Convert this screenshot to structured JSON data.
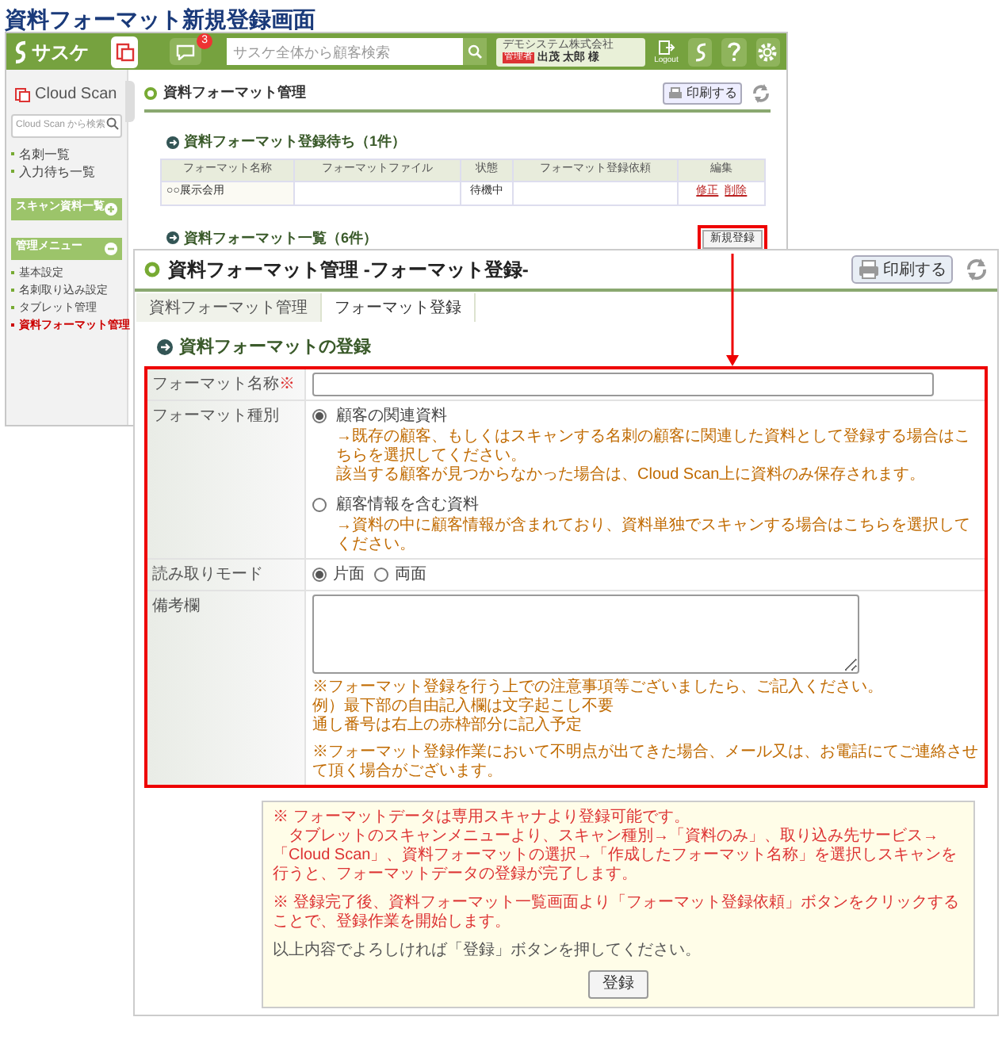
{
  "page_title": "資料フォーマット新規登録画面",
  "back_window": {
    "header": {
      "logo": "サスケ",
      "message_count": "3",
      "search_placeholder": "サスケ全体から顧客検索",
      "company": "デモシステム株式会社",
      "role_badge": "管理者",
      "user_name": "出茂 太郎 様",
      "logout_label": "Logout"
    },
    "sidebar": {
      "title": "Cloud Scan",
      "search_placeholder": "Cloud Scan から検索",
      "links": [
        "名刺一覧",
        "入力待ち一覧"
      ],
      "sections": [
        {
          "label": "スキャン資料一覧",
          "expanded": false
        },
        {
          "label": "管理メニュー",
          "expanded": true,
          "items": [
            {
              "label": "基本設定",
              "selected": false
            },
            {
              "label": "名刺取り込み設定",
              "selected": false
            },
            {
              "label": "タブレット管理",
              "selected": false
            },
            {
              "label": "資料フォーマット管理",
              "selected": true
            }
          ]
        }
      ]
    },
    "main": {
      "title": "資料フォーマット管理",
      "print_label": "印刷する",
      "pending": {
        "heading": "資料フォーマット登録待ち（1件）",
        "columns": [
          "フォーマット名称",
          "フォーマットファイル",
          "状態",
          "フォーマット登録依頼",
          "編集"
        ],
        "rows": [
          {
            "name": "○○展示会用",
            "status": "待機中",
            "actions": [
              "修正",
              "削除"
            ]
          }
        ]
      },
      "list": {
        "heading": "資料フォーマット一覧（6件）",
        "new_button": "新規登録"
      }
    }
  },
  "front_window": {
    "title": "資料フォーマット管理 -フォーマット登録-",
    "print_label": "印刷する",
    "breadcrumbs": [
      {
        "label": "資料フォーマット管理",
        "selected": false
      },
      {
        "label": "フォーマット登録",
        "selected": true
      }
    ],
    "section_heading": "資料フォーマットの登録",
    "form": [
      {
        "kind": "text",
        "label": "フォーマット名称",
        "required_mark": "※"
      },
      {
        "kind": "radio_list",
        "label": "フォーマット種別",
        "options": [
          {
            "label": "顧客の関連資料",
            "selected": true,
            "notes": [
              "→既存の顧客、もしくはスキャンする名刺の顧客に関連した資料として登録する場合はこちらを選択してください。",
              "該当する顧客が見つからなかった場合は、Cloud Scan上に資料のみ保存されます。"
            ]
          },
          {
            "label": "顧客情報を含む資料",
            "selected": false,
            "notes": [
              "→資料の中に顧客情報が含まれており、資料単独でスキャンする場合はこちらを選択してください。"
            ]
          }
        ]
      },
      {
        "kind": "radio_inline",
        "label": "読み取りモード",
        "options": [
          {
            "label": "片面",
            "selected": true
          },
          {
            "label": "両面",
            "selected": false
          }
        ]
      },
      {
        "kind": "textarea",
        "label": "備考欄",
        "notes": [
          "※フォーマット登録を行う上での注意事項等ございましたら、ご記入ください。",
          "例）最下部の自由記入欄は文字起こし不要",
          "通し番号は右上の赤枠部分に記入予定"
        ],
        "footnote": "※フォーマット登録作業において不明点が出てきた場合、メール又は、お電話にてご連絡させて頂く場合がございます。"
      }
    ],
    "notice": {
      "paragraphs": [
        {
          "kind": "note",
          "text": "※ フォーマットデータは専用スキャナより登録可能です。"
        },
        {
          "kind": "indent",
          "text": "タブレットのスキャンメニューより、スキャン種別→「資料のみ」、取り込み先サービス→「Cloud Scan」、資料フォーマットの選択→「作成したフォーマット名称」を選択しスキャンを行うと、フォーマットデータの登録が完了します。"
        },
        {
          "kind": "note",
          "text": "※ 登録完了後、資料フォーマット一覧画面より「フォーマット登録依頼」ボタンをクリックすることで、登録作業を開始します。"
        },
        {
          "kind": "plain",
          "text": "以上内容でよろしければ「登録」ボタンを押してください。"
        }
      ],
      "submit_label": "登録"
    }
  }
}
